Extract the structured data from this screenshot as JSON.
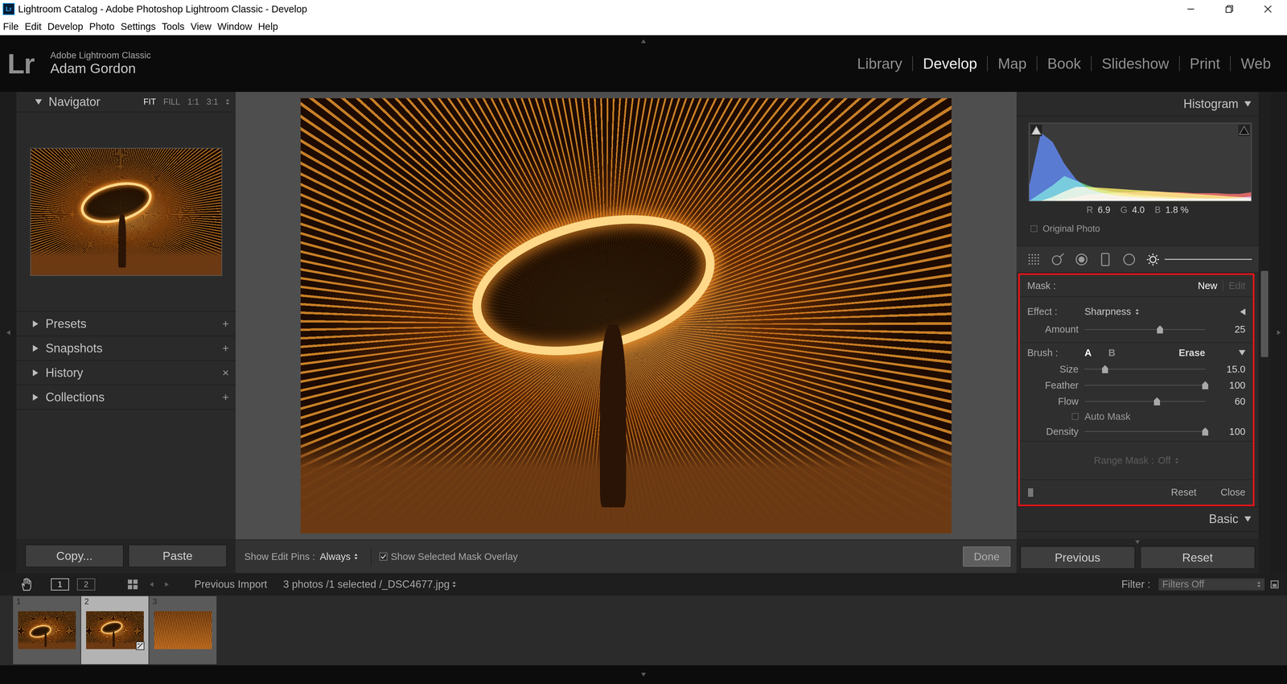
{
  "window": {
    "title": "Lightroom Catalog - Adobe Photoshop Lightroom Classic - Develop"
  },
  "menu": [
    "File",
    "Edit",
    "Develop",
    "Photo",
    "Settings",
    "Tools",
    "View",
    "Window",
    "Help"
  ],
  "identity": {
    "logo": "Lr",
    "product": "Adobe Lightroom Classic",
    "user": "Adam Gordon"
  },
  "modules": [
    {
      "label": "Library",
      "selected": false
    },
    {
      "label": "Develop",
      "selected": true
    },
    {
      "label": "Map",
      "selected": false
    },
    {
      "label": "Book",
      "selected": false
    },
    {
      "label": "Slideshow",
      "selected": false
    },
    {
      "label": "Print",
      "selected": false
    },
    {
      "label": "Web",
      "selected": false
    }
  ],
  "navigator": {
    "title": "Navigator",
    "expanded": true,
    "zoom": [
      {
        "label": "FIT",
        "selected": true
      },
      {
        "label": "FILL",
        "selected": false
      },
      {
        "label": "1:1",
        "selected": false
      },
      {
        "label": "3:1",
        "selected": false
      }
    ]
  },
  "left_panels": [
    {
      "title": "Presets",
      "expanded": false,
      "action": "+"
    },
    {
      "title": "Snapshots",
      "expanded": false,
      "action": "+"
    },
    {
      "title": "History",
      "expanded": false,
      "action": "×"
    },
    {
      "title": "Collections",
      "expanded": false,
      "action": "+"
    }
  ],
  "left_buttons": [
    "Copy...",
    "Paste"
  ],
  "histogram": {
    "title": "Histogram",
    "expanded": true,
    "series": [
      {
        "color": "#e0413f",
        "values": [
          0,
          0,
          0,
          2,
          5,
          8,
          9,
          10,
          11,
          11,
          12,
          12,
          11,
          11,
          10,
          10,
          10,
          9,
          9,
          11
        ]
      },
      {
        "color": "#d9cb35",
        "values": [
          0,
          0,
          5,
          12,
          18,
          18,
          17,
          16,
          15,
          14,
          13,
          12,
          11,
          10,
          9,
          8,
          7,
          6,
          5,
          4
        ]
      },
      {
        "color": "#31a94c",
        "values": [
          0,
          10,
          20,
          32,
          26,
          20,
          15,
          12,
          10,
          8,
          7,
          6,
          5,
          4,
          4,
          3,
          3,
          3,
          3,
          3
        ]
      },
      {
        "color": "#2d5bd6",
        "values": [
          20,
          88,
          76,
          48,
          28,
          16,
          11,
          8,
          6,
          5,
          4,
          4,
          3,
          3,
          3,
          3,
          3,
          3,
          4,
          6
        ]
      }
    ],
    "clipping": [
      {
        "kind": "shadows",
        "on": true
      },
      {
        "kind": "highlights",
        "on": false
      }
    ],
    "readout": [
      {
        "label": "R",
        "value": "6.9"
      },
      {
        "label": "G",
        "value": "4.0"
      },
      {
        "label": "B",
        "value": "1.8 %"
      }
    ],
    "original_photo": {
      "label": "Original Photo",
      "checked": false
    }
  },
  "tools": [
    {
      "kind": "crop",
      "selected": false
    },
    {
      "kind": "spot",
      "selected": false
    },
    {
      "kind": "redeye",
      "selected": false
    },
    {
      "kind": "graduated",
      "selected": false
    },
    {
      "kind": "radial",
      "selected": false
    },
    {
      "kind": "brush",
      "selected": true
    }
  ],
  "mask": {
    "highlighted": true,
    "label": "Mask :",
    "actions": [
      {
        "label": "New",
        "selected": true,
        "disabled": false
      },
      {
        "label": "Edit",
        "selected": false,
        "disabled": true
      }
    ],
    "effect": {
      "label": "Effect :",
      "value": "Sharpness",
      "expanded": false
    },
    "amount": {
      "label": "Amount",
      "level": 0.625,
      "reading": "25"
    },
    "brush": {
      "label": "Brush :",
      "expanded": true,
      "modes": [
        {
          "label": "A",
          "selected": true
        },
        {
          "label": "B",
          "selected": false
        },
        {
          "label": "Erase",
          "selected": false
        }
      ]
    },
    "controls": [
      {
        "kind": "slider",
        "label": "Size",
        "level": 0.17,
        "reading": "15.0"
      },
      {
        "kind": "slider",
        "label": "Feather",
        "level": 1,
        "reading": "100"
      },
      {
        "kind": "slider",
        "label": "Flow",
        "level": 0.6,
        "reading": "60"
      },
      {
        "kind": "checkbox",
        "label": "Auto Mask",
        "checked": false
      },
      {
        "kind": "slider",
        "label": "Density",
        "level": 1,
        "reading": "100"
      }
    ],
    "range_mask": {
      "label": "Range Mask :",
      "value": "Off",
      "disabled": true
    },
    "switch": {
      "on": true
    },
    "buttons": [
      "Reset",
      "Close"
    ]
  },
  "basic": {
    "title": "Basic",
    "expanded": true
  },
  "right_buttons": [
    "Previous",
    "Reset"
  ],
  "scrollbar": {
    "offset": 0.372,
    "size": 0.179
  },
  "toolbar": {
    "pins_label": "Show Edit Pins :",
    "pins_value": "Always",
    "overlay": {
      "label": "Show Selected Mask Overlay",
      "checked": true
    },
    "done": {
      "label": "Done",
      "disabled": false
    }
  },
  "filmstrip_bar": {
    "views": [
      {
        "label": "1",
        "selected": true
      },
      {
        "label": "2",
        "selected": false
      }
    ],
    "source": "Previous Import",
    "info": "3 photos /1 selected /_DSC4677.jpg",
    "filter_label": "Filter :",
    "filter_value": "Filters Off"
  },
  "filmstrip": [
    {
      "number": "1",
      "selected": false,
      "edited": false
    },
    {
      "number": "2",
      "selected": true,
      "edited": true
    },
    {
      "number": "3",
      "selected": false,
      "edited": false
    }
  ]
}
